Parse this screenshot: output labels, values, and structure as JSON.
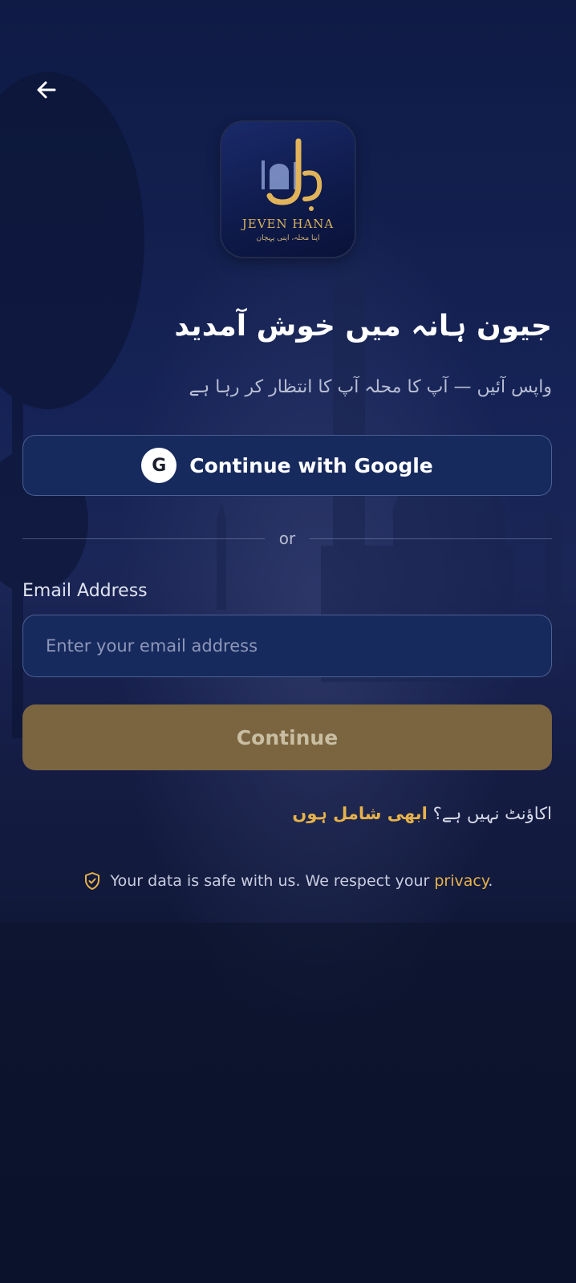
{
  "header": {
    "back_icon": "arrow-left-icon"
  },
  "logo": {
    "name": "JEVEN HANA",
    "tagline": "اپنا محلہ، اپنی پہچان"
  },
  "welcome": {
    "title": "جیون ہانہ میں خوش آمدید",
    "subtitle": "واپس آئیں — آپ کا محلہ آپ کا انتظار کر رہا ہے"
  },
  "google": {
    "icon_letter": "G",
    "label": "Continue with Google"
  },
  "divider": {
    "text": "or"
  },
  "email": {
    "label": "Email Address",
    "placeholder": "Enter your email address",
    "value": ""
  },
  "continue": {
    "label": "Continue"
  },
  "signup": {
    "prompt": "اکاؤنٹ نہیں ہے؟",
    "link": "ابھی شامل ہوں"
  },
  "privacy": {
    "text": "Your data is safe with us. We respect your",
    "link": "privacy",
    "suffix": ".",
    "icon": "shield-check-icon"
  },
  "colors": {
    "background": "#0f1a3a",
    "accent_gold": "#e6b24a",
    "button_disabled": "#7a6540",
    "field_bg": "#172a5e"
  }
}
